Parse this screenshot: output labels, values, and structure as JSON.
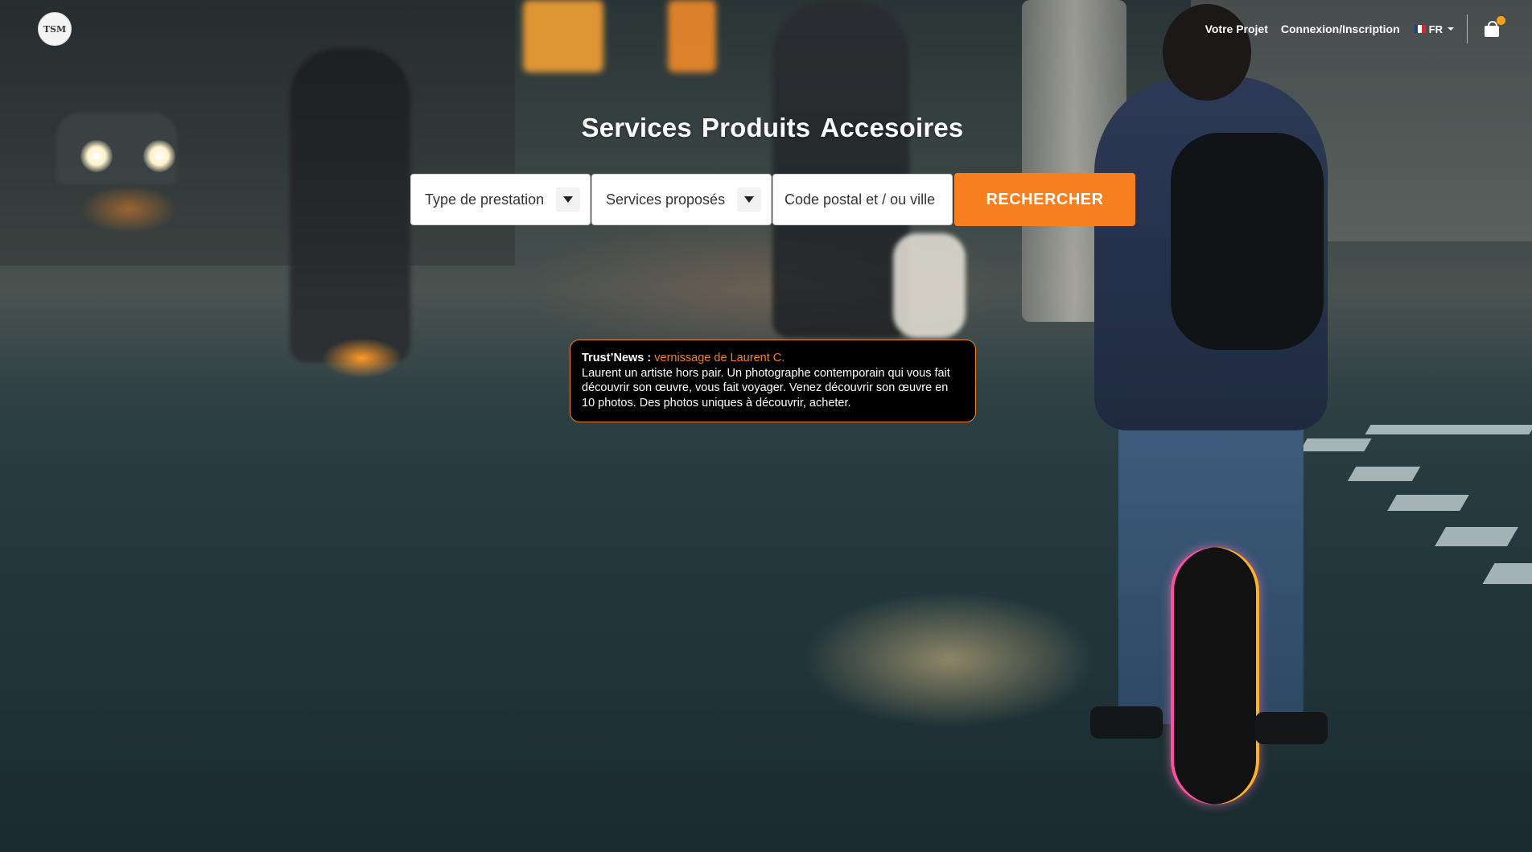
{
  "header": {
    "logo_text": "TSM",
    "nav": {
      "project_label": "Votre Projet",
      "login_label": "Connexion/Inscription",
      "language": "FR",
      "flag_colors": [
        "#1f3d99",
        "#ffffff",
        "#e4202a"
      ]
    },
    "cart": {
      "icon": "shopping-bag-icon",
      "badge_color": "#f7a21b"
    }
  },
  "hero": {
    "title_words": [
      "Services",
      "Produits",
      "Accesoires"
    ]
  },
  "search": {
    "type_select": {
      "value": "Type de prestation",
      "icon": "caret-down-icon"
    },
    "services_select": {
      "value": "Services proposés",
      "icon": "caret-down-icon"
    },
    "location_input": {
      "placeholder": "Code postal et / ou ville",
      "value": ""
    },
    "submit_label": "RECHERCHER",
    "accent_color": "#f97e1d"
  },
  "news": {
    "label": "Trust’News : ",
    "headline": "vernissage de Laurent C.",
    "body": "Laurent un artiste hors pair. Un photographe contemporain qui vous fait découvrir son œuvre, vous fait voyager. Venez découvrir son œuvre en 10 photos. Des photos uniques à découvrir, acheter."
  }
}
